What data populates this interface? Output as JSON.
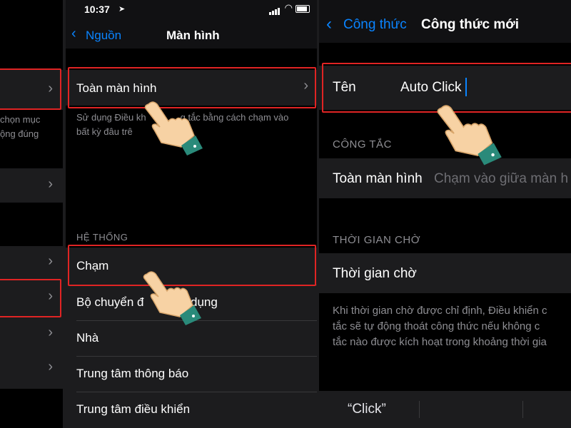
{
  "panel1": {
    "desc_line1": "chọn mục",
    "desc_line2": "ộng đúng"
  },
  "panel2": {
    "status_time": "10:37",
    "back_label": "Nguồn",
    "title": "Màn hình",
    "full_screen_label": "Toàn màn hình",
    "full_screen_desc_left": "Sử dụng Điều kh",
    "full_screen_desc_right": "g tắc bằng cách chạm vào",
    "full_screen_desc_line2": "bất kỳ đâu trê",
    "system_header": "HỆ THỐNG",
    "items": [
      "Chạm",
      "Bộ chuyển đ",
      "Nhà",
      "Trung tâm thông báo",
      "Trung tâm điều khiển"
    ],
    "app_switcher_tail": "dụng"
  },
  "panel3": {
    "back_label": "Công thức",
    "title": "Công thức mới",
    "name_label": "Tên",
    "name_value": "Auto Click",
    "trigger_header": "CÔNG TẮC",
    "trigger_label": "Toàn màn hình",
    "trigger_value": "Chạm vào giữa màn h",
    "timeout_header": "THỜI GIAN CHỜ",
    "timeout_label": "Thời gian chờ",
    "timeout_desc": [
      "Khi thời gian chờ được chỉ định, Điều khiển c",
      "tắc sẽ tự động thoát công thức nếu không c",
      "tắc nào được kích hoạt trong khoảng thời gia"
    ],
    "bottom_action": "“Click”"
  },
  "colors": {
    "accent": "#0a84ff",
    "highlight": "#e02424",
    "cell_bg": "#1c1c1e",
    "hand_skin": "#f7d2a4",
    "cuff": "#2a8a7a"
  }
}
